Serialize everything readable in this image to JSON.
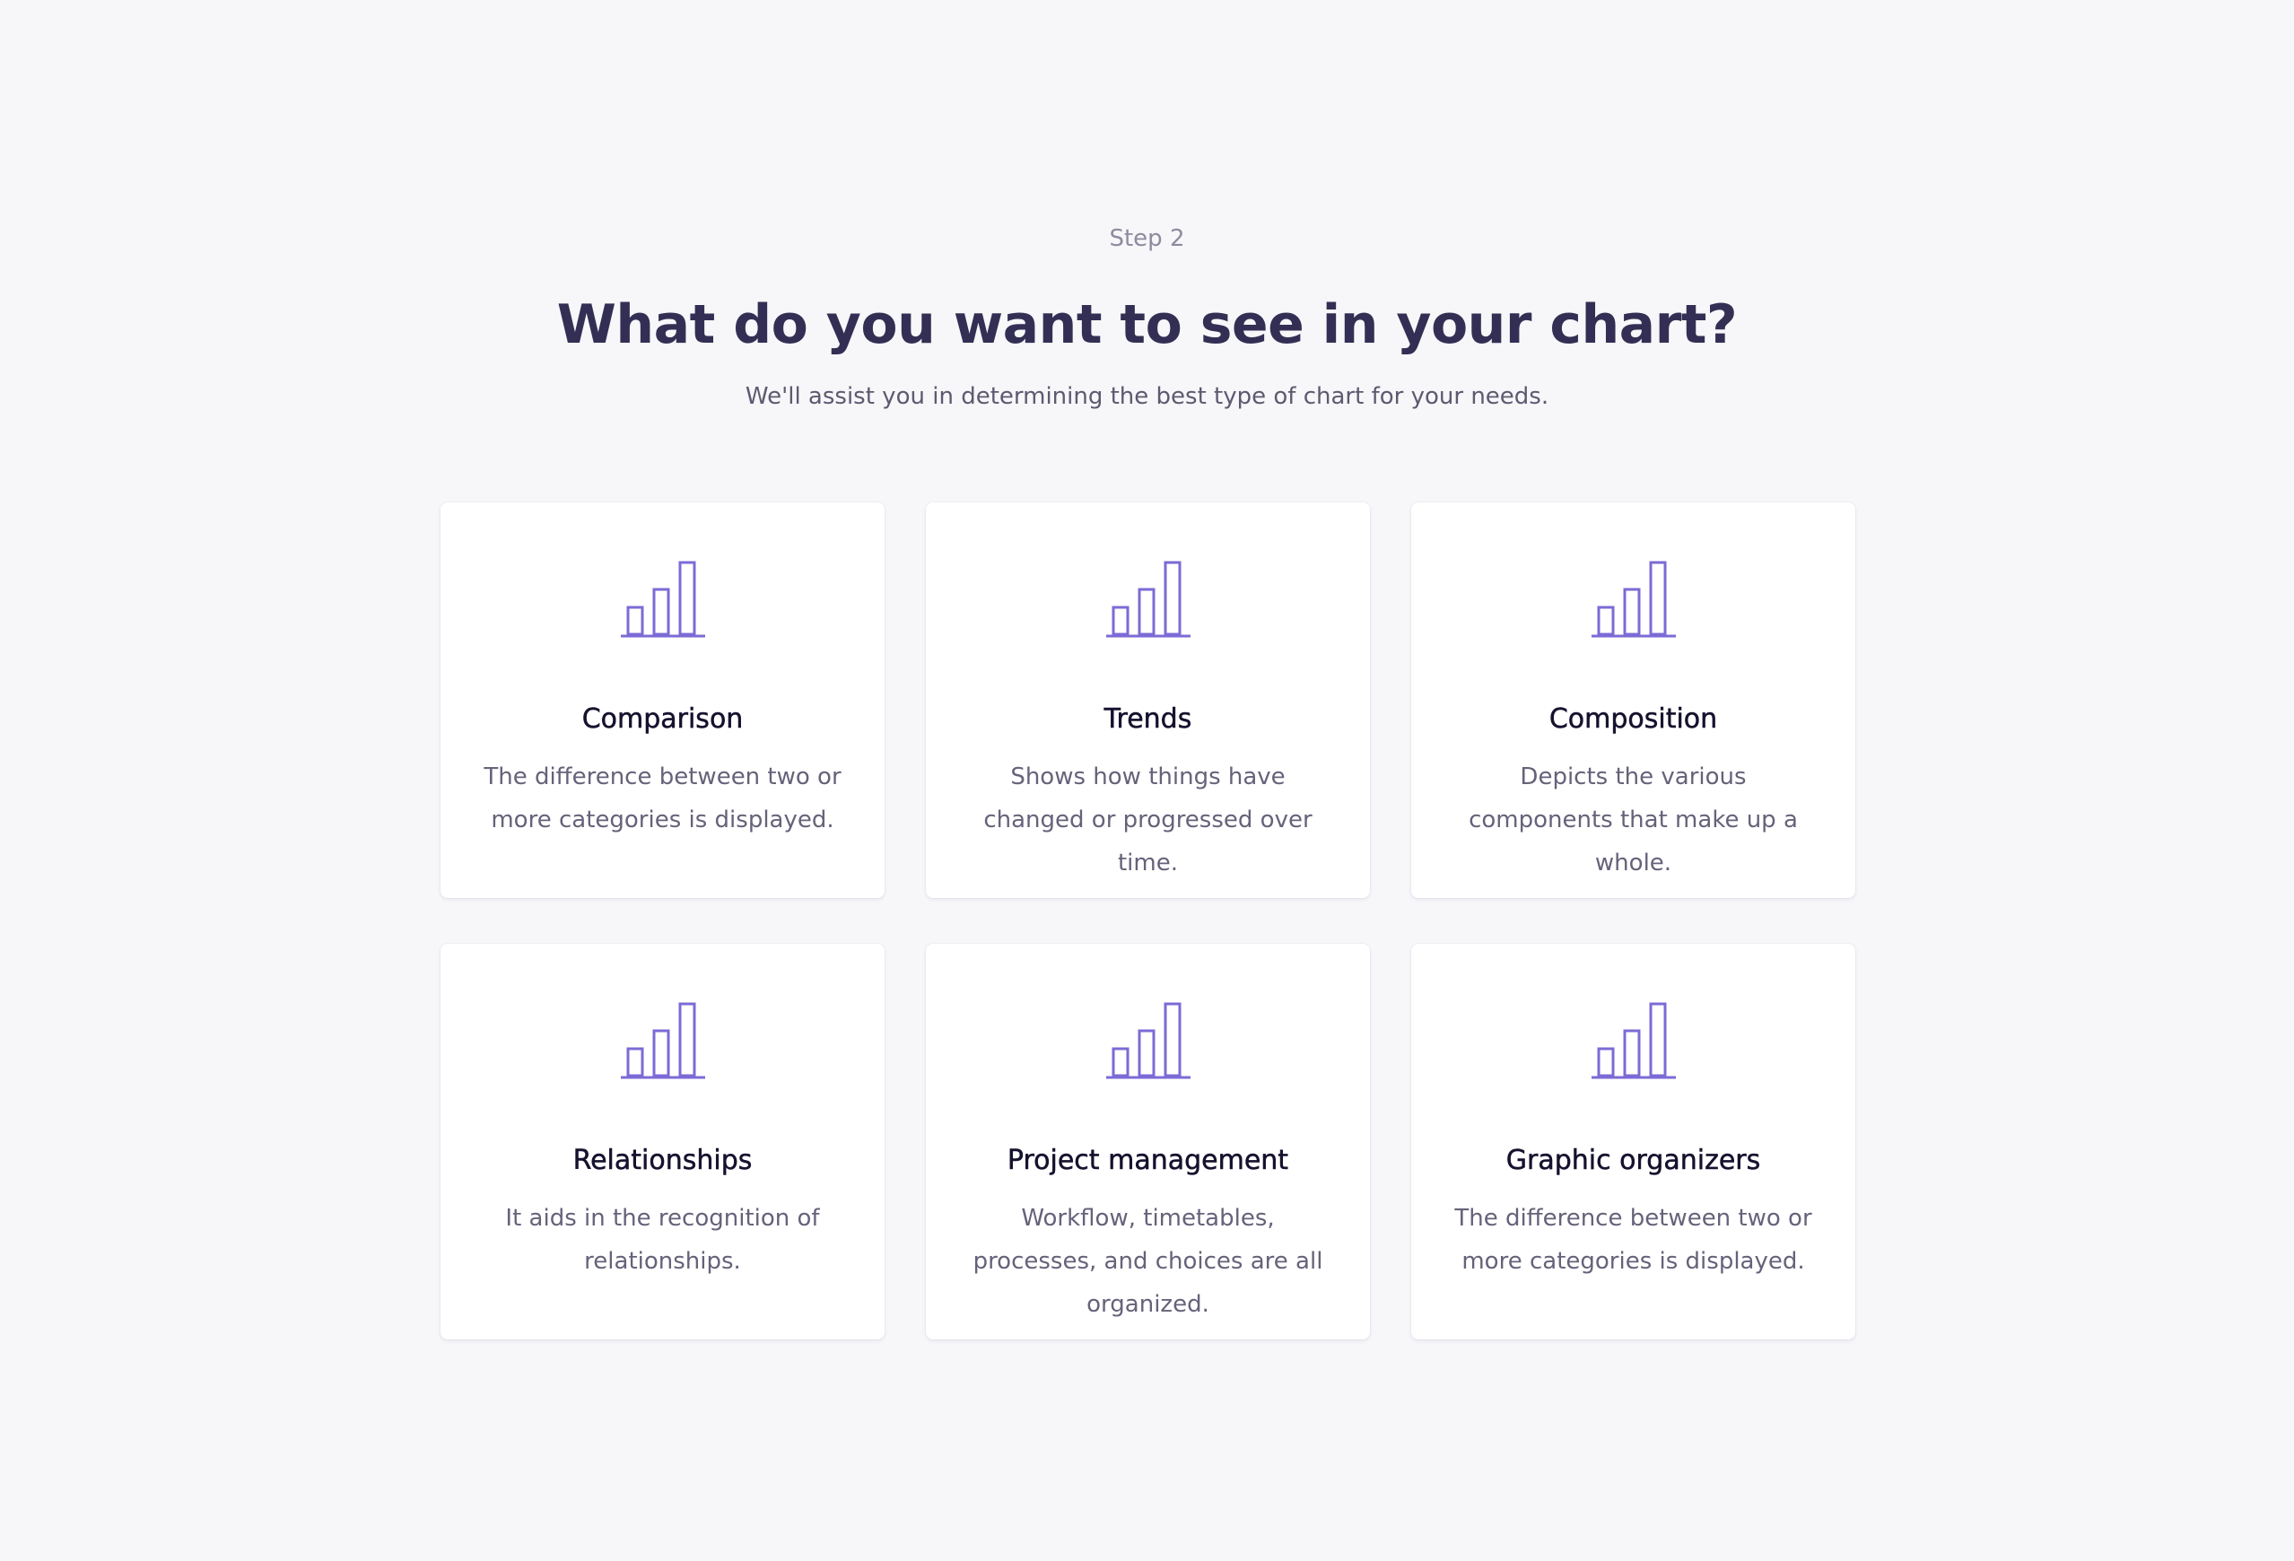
{
  "header": {
    "step": "Step 2",
    "title": "What do you want to see in your chart?",
    "subtitle": "We'll assist you in determining the best type of chart for your needs."
  },
  "cards": [
    {
      "title": "Comparison",
      "description": "The difference between two or more categories is displayed.",
      "icon": "bar-chart-icon"
    },
    {
      "title": "Trends",
      "description": "Shows how things have changed or progressed over time.",
      "icon": "bar-chart-icon"
    },
    {
      "title": "Composition",
      "description": "Depicts the various components that make up a whole.",
      "icon": "bar-chart-icon"
    },
    {
      "title": "Relationships",
      "description": "It aids in the recognition of relationships.",
      "icon": "bar-chart-icon"
    },
    {
      "title": "Project management",
      "description": "Workflow, timetables, processes, and choices are all organized.",
      "icon": "bar-chart-icon"
    },
    {
      "title": "Graphic organizers",
      "description": "The difference between two or more categories is displayed.",
      "icon": "bar-chart-icon"
    }
  ],
  "colors": {
    "background": "#f7f6f9",
    "card": "#ffffff",
    "accent": "#7b6bd6",
    "title": "#332f54",
    "card_title": "#15122e",
    "muted": "#66627a"
  }
}
